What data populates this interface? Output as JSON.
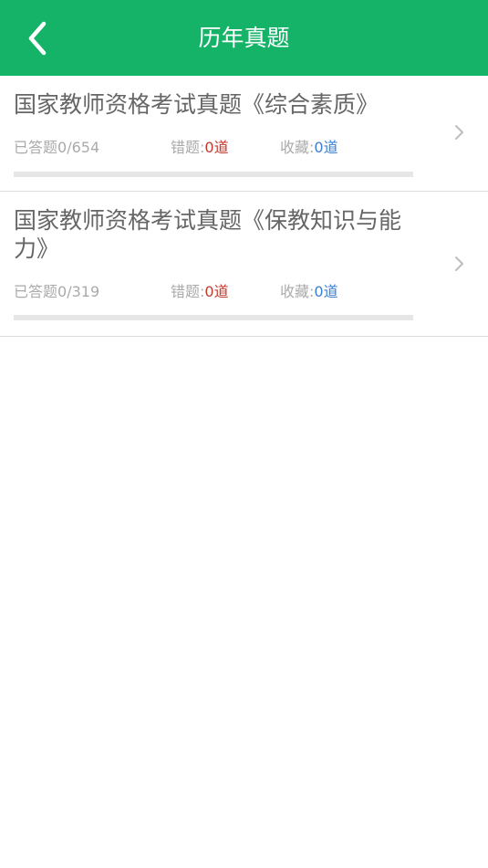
{
  "header": {
    "title": "历年真题",
    "back_icon": "chevron-left-icon",
    "color": "#15b368"
  },
  "items": [
    {
      "title": "国家教师资格考试真题《综合素质》",
      "answered_label": "已答题",
      "answered_value": "0/654",
      "answered_progress": 0,
      "wrong_label": "错题:",
      "wrong_value": "0道",
      "fav_label": "收藏:",
      "fav_value": "0道"
    },
    {
      "title": "国家教师资格考试真题《保教知识与能力》",
      "answered_label": "已答题",
      "answered_value": "0/319",
      "answered_progress": 0,
      "wrong_label": "错题:",
      "wrong_value": "0道",
      "fav_label": "收藏:",
      "fav_value": "0道"
    }
  ],
  "colors": {
    "wrong_value": "#c0392b",
    "fav_value": "#3a7fd5",
    "muted_text": "#aaaaaa",
    "title_text": "#666666"
  }
}
